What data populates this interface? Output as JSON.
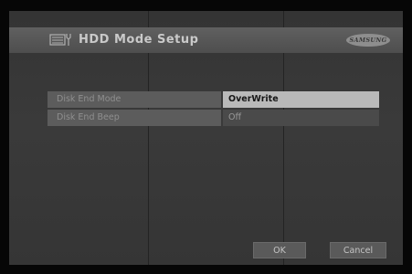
{
  "header": {
    "title": "HDD Mode Setup",
    "brand": "SAMSUNG",
    "icon": "hdd-icon"
  },
  "settings": [
    {
      "label": "Disk End Mode",
      "value": "OverWrite",
      "selected": true
    },
    {
      "label": "Disk End Beep",
      "value": "Off",
      "selected": false
    }
  ],
  "buttons": {
    "ok": "OK",
    "cancel": "Cancel"
  }
}
